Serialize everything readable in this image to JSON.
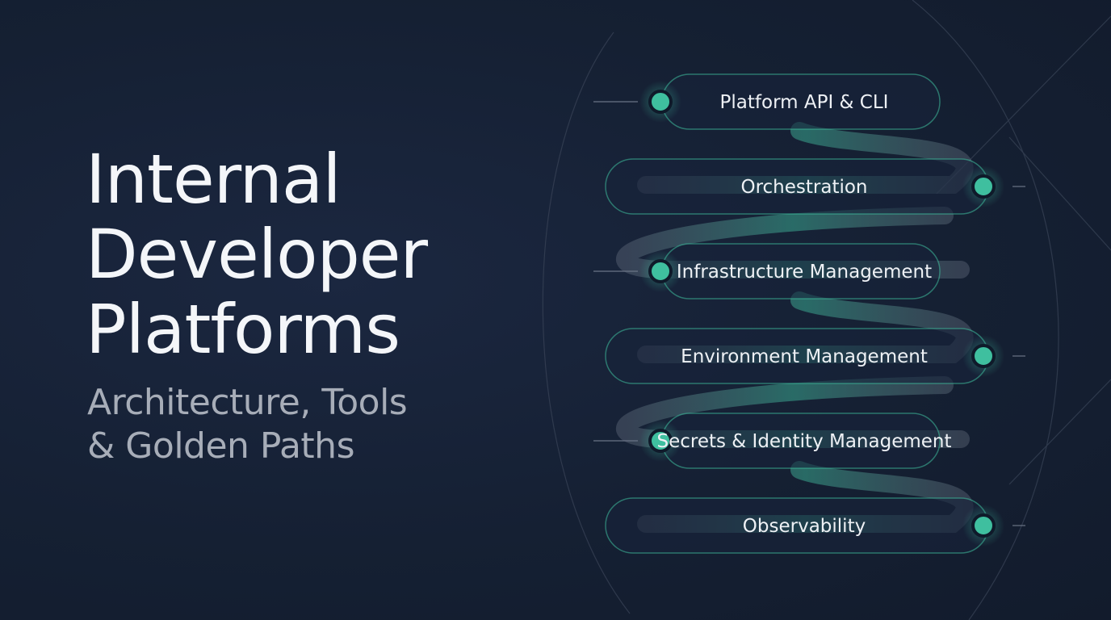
{
  "title": {
    "lines": [
      "Internal",
      "Developer",
      "Platforms"
    ]
  },
  "subtitle": {
    "lines": [
      "Architecture, Tools",
      "& Golden Paths"
    ]
  },
  "diagram": {
    "layers": [
      {
        "label": "Platform API & CLI",
        "node_side": "left"
      },
      {
        "label": "Orchestration",
        "node_side": "right"
      },
      {
        "label": "Infrastructure Management",
        "node_side": "left"
      },
      {
        "label": "Environment Management",
        "node_side": "right"
      },
      {
        "label": "Secrets & Identity Management",
        "node_side": "left"
      },
      {
        "label": "Observability",
        "node_side": "right"
      }
    ]
  },
  "colors": {
    "background": "#152033",
    "title": "#f4f6f9",
    "subtitle": "#a7adb8",
    "accent": "#3fbf9f",
    "ribbon": "#8a93a2"
  }
}
